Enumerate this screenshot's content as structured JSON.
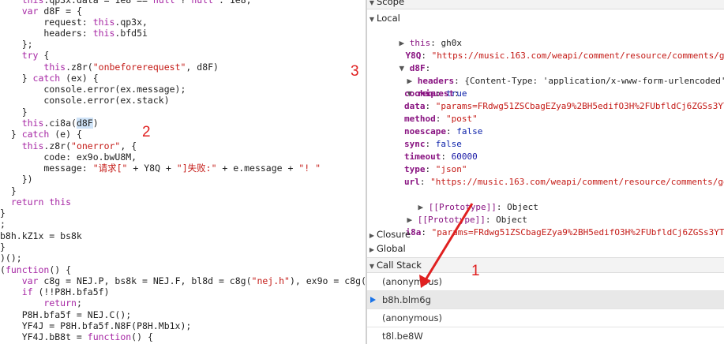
{
  "code": {
    "lines": [
      "    this.qp3x.data = 1e8 == null ? null : 1e8;",
      "    var d8F = {",
      "        request: this.qp3x,",
      "        headers: this.bfd5i",
      "    };",
      "    try {",
      "        this.z8r(\"onbeforerequest\", d8F)",
      "    } catch (ex) {",
      "        console.error(ex.message);",
      "        console.error(ex.stack)",
      "    }",
      "    this.ci8a(d8F)",
      "  } catch (e) {",
      "    this.z8r(\"onerror\", {",
      "        code: ex9o.bwU8M,",
      "        message: \"请求[\" + Y8Q + \"]失败:\" + e.message + \"! \"",
      "    })",
      "  }",
      "  return this",
      "}",
      ";",
      "b8h.kZ1x = bs8k",
      "}",
      ")();",
      "(function() {",
      "    var c8g = NEJ.P, bs8k = NEJ.F, bl8d = c8g(\"nej.h\"), ex9o = c8g(\"",
      "    if (!!P8H.bfa5f)",
      "        return;",
      "    P8H.bfa5f = NEJ.C();",
      "    YF4J = P8H.bfa5f.N8F(P8H.Mb1x);",
      "    YF4J.bB8t = function() {"
    ]
  },
  "scope": {
    "top_label": "Scope",
    "local_label": "Local",
    "this_label": "this",
    "this_value": "gh0x",
    "y8q_label": "Y8Q",
    "y8q_value": "\"https://music.163.com/weapi/comment/resource/comments/get?c",
    "d8f_label": "d8F",
    "headers_label": "headers",
    "headers_value": "{Content-Type: 'application/x-www-form-urlencoded'}",
    "request_label": "request",
    "request_props": [
      {
        "key": "cookie",
        "value": "true",
        "kind": "bool"
      },
      {
        "key": "data",
        "value": "\"params=FRdwg51ZSCbagEZya9%2BH5edifO3H%2FUbfldCj6ZGSs3YT",
        "kind": "str"
      },
      {
        "key": "method",
        "value": "\"post\"",
        "kind": "str"
      },
      {
        "key": "noescape",
        "value": "false",
        "kind": "bool"
      },
      {
        "key": "sync",
        "value": "false",
        "kind": "bool"
      },
      {
        "key": "timeout",
        "value": "60000",
        "kind": "num"
      },
      {
        "key": "type",
        "value": "\"json\"",
        "kind": "str"
      },
      {
        "key": "url",
        "value": "\"https://music.163.com/weapi/comment/resource/comments/ge",
        "kind": "str"
      }
    ],
    "proto_label": "[[Prototype]]",
    "proto_value": "Object",
    "i8a_label": "i8a",
    "i8a_value": "\"params=FRdwg51ZSCbagEZya9%2BH5edifO3H%2FUbfldCj6ZGSs3YT06kt",
    "closure_label": "Closure",
    "global_label": "Global"
  },
  "callstack": {
    "label": "Call Stack",
    "frames": [
      "(anonymous)",
      "b8h.blm6g",
      "(anonymous)",
      "t8l.be8W"
    ]
  },
  "annotations": [
    "1",
    "2",
    "3"
  ],
  "colors": {
    "arrow": "#e02020",
    "highlight": "#cfe3f7",
    "pointer": "#1a73e8"
  }
}
